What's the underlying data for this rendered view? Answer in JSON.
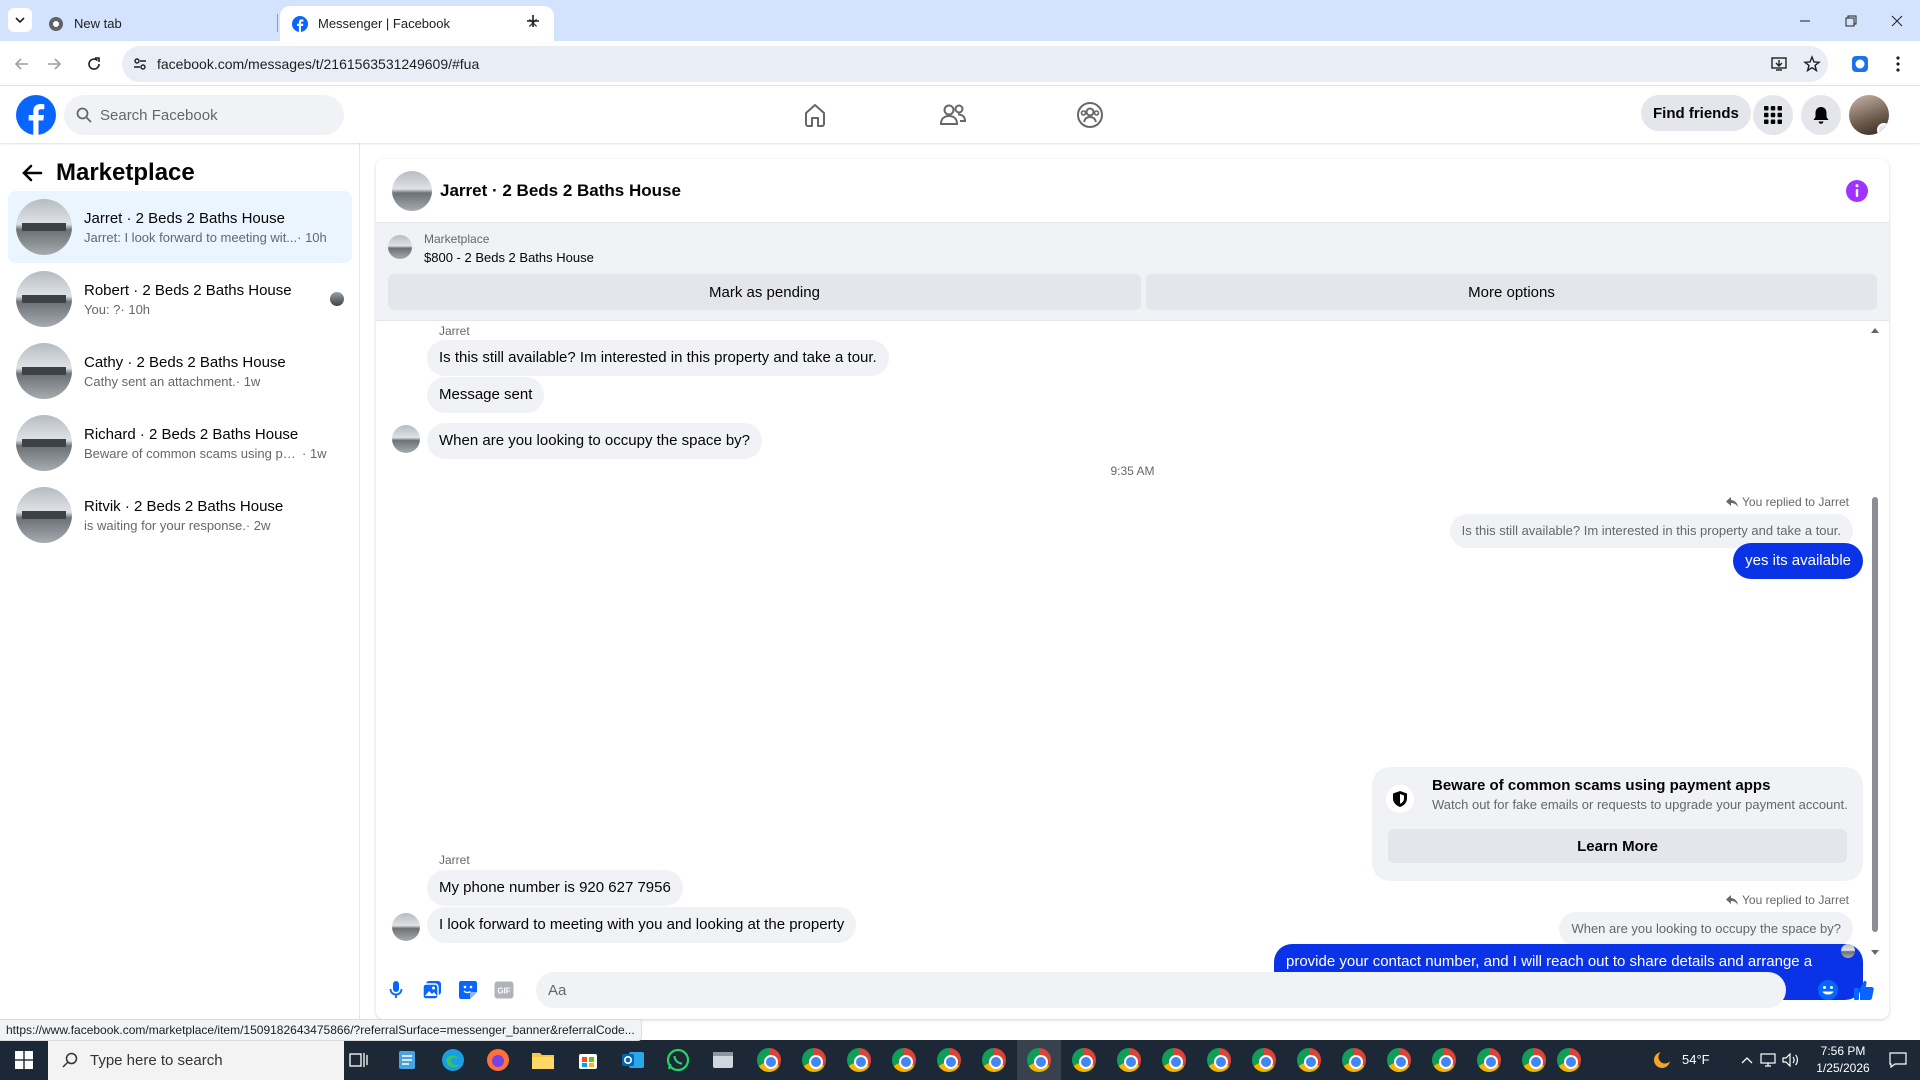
{
  "browser": {
    "tabs": [
      {
        "title": "New tab"
      },
      {
        "title": "Messenger | Facebook"
      }
    ],
    "url": "facebook.com/messages/t/2161563531249609/#fua",
    "status_url": "https://www.facebook.com/marketplace/item/1509182643475866/?referralSurface=messenger_banner&referralCode..."
  },
  "fb_header": {
    "search_placeholder": "Search Facebook",
    "find_friends_label": "Find friends"
  },
  "left_panel": {
    "title": "Marketplace",
    "conversations": [
      {
        "name": "Jarret · 2 Beds 2 Baths House",
        "snippet": "Jarret: I look forward to meeting wit...",
        "time": " · 10h"
      },
      {
        "name": "Robert · 2 Beds 2 Baths House",
        "snippet": "You: ?",
        "time": " · 10h"
      },
      {
        "name": "Cathy · 2 Beds 2 Baths House",
        "snippet": "Cathy sent an attachment.",
        "time": " · 1w"
      },
      {
        "name": "Richard · 2 Beds 2 Baths House",
        "snippet": "Beware of common scams using pay...",
        "time": " · 1w"
      },
      {
        "name": "Ritvik · 2 Beds 2 Baths House",
        "snippet": "is waiting for your response.",
        "time": " · 2w"
      }
    ]
  },
  "chat": {
    "title": "Jarret · 2 Beds 2 Baths House",
    "listing": {
      "source": "Marketplace",
      "title": "$800 - 2 Beds 2 Baths House",
      "mark_pending_label": "Mark as pending",
      "more_options_label": "More options"
    },
    "messages": {
      "sender_1": "Jarret",
      "in_1": "Is this still available? Im interested in this property and take a tour.",
      "in_2": "Message sent",
      "in_3": "When are you looking to occupy the space by?",
      "timestamp": "9:35 AM",
      "replied_1": "You replied to Jarret",
      "quote_1": "Is this still available? Im interested in this property and take a tour.",
      "out_1": "yes its available",
      "scam_title": "Beware of common scams using payment apps",
      "scam_body": "Watch out for fake emails or requests to upgrade your payment account.",
      "scam_button": "Learn More",
      "replied_2": "You replied to Jarret",
      "quote_2": "When are you looking to occupy the space by?",
      "out_2": "provide your contact number, and I will reach out to share  details and arrange a convenient time for a viewing.",
      "sender_2": "Jarret",
      "in_4": "My phone number is 920 627 7956",
      "in_5": "I look forward to meeting with you and looking at the property"
    },
    "composer_placeholder": "Aa"
  },
  "taskbar": {
    "search_placeholder": "Type here to search",
    "weather": "54°F",
    "time": "7:56 PM",
    "date": "1/25/2026"
  },
  "colors": {
    "facebook_blue": "#0866ff",
    "outgoing_bubble": "#0a33e8",
    "info_purple": "#a033ff"
  }
}
